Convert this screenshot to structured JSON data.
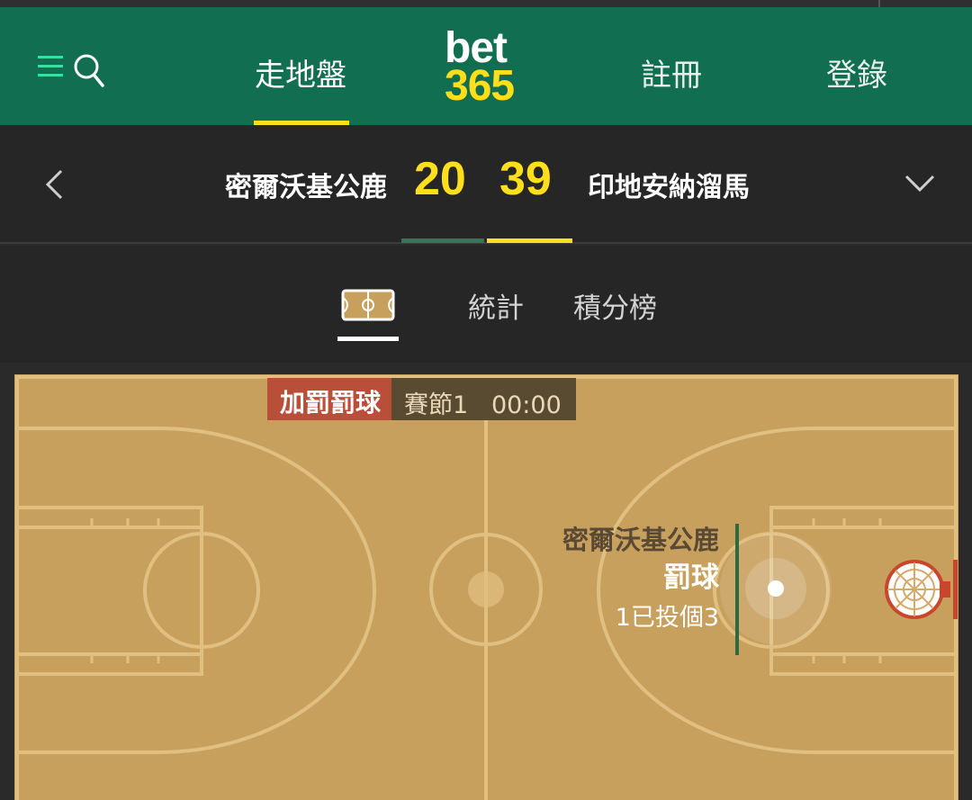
{
  "header": {
    "nav_live": "走地盤",
    "nav_register": "註冊",
    "nav_login": "登錄",
    "logo_top": "bet",
    "logo_bottom": "365",
    "brand_green": "#126e51",
    "accent_yellow": "#ffdf1b",
    "icons": [
      "menu-icon",
      "search-icon"
    ]
  },
  "scoreboard": {
    "home_team": "密爾沃基公鹿",
    "home_score": "20",
    "away_score": "39",
    "away_team": "印地安納溜馬",
    "icons": [
      "chevron-left-icon",
      "chevron-down-icon"
    ]
  },
  "tabs": {
    "court_icon": "court-icon",
    "stats": "統計",
    "standings": "積分榜",
    "active": "court"
  },
  "court": {
    "event_type": "加罰罰球",
    "period": "賽節1",
    "clock": "00:00",
    "play_team": "密爾沃基公鹿",
    "play_action": "罰球",
    "play_count": "1已投個3",
    "court_color": "#c8a05e",
    "event_color": "#b94e39"
  }
}
